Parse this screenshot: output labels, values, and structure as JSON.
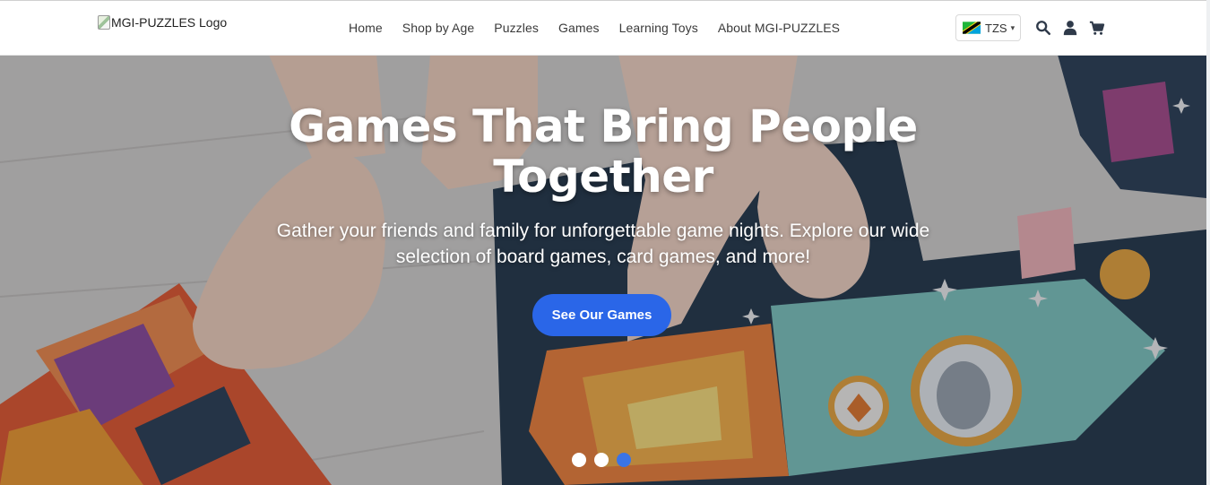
{
  "brand": {
    "logo_alt": "MGI-PUZZLES Logo"
  },
  "nav": {
    "items": [
      "Home",
      "Shop by Age",
      "Puzzles",
      "Games",
      "Learning Toys",
      "About MGI-PUZZLES"
    ]
  },
  "currency": {
    "code": "TZS",
    "flag": "tanzania-flag"
  },
  "header_icons": [
    "search-icon",
    "user-icon",
    "cart-icon"
  ],
  "hero": {
    "title": "Games That Bring People Together",
    "subtitle": "Gather your friends and family for unforgettable game nights. Explore our wide selection of board games, card games, and more!",
    "cta_label": "See Our Games",
    "slides_total": 3,
    "active_slide": 3
  },
  "colors": {
    "primary": "#2a66e8",
    "active_dot": "#3b74e6",
    "nav_text": "#3a3a3a",
    "header_bg": "#ffffff"
  }
}
